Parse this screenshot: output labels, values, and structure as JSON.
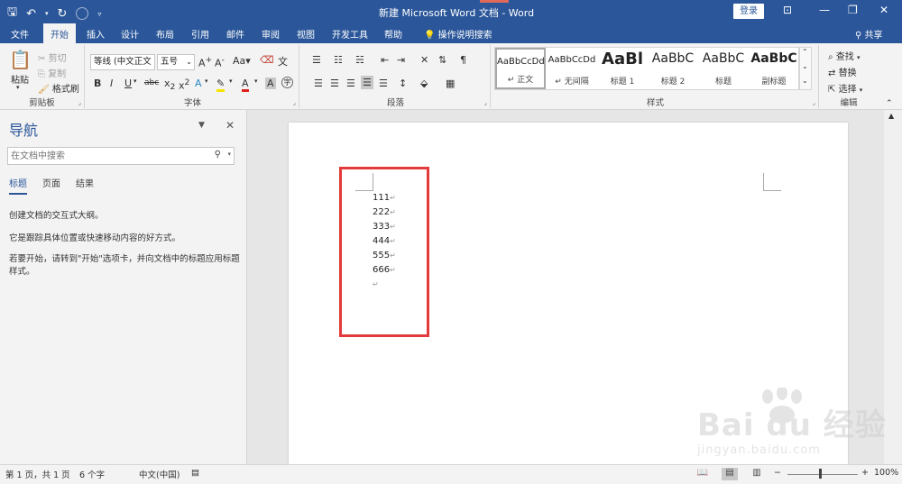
{
  "titlebar": {
    "title": "新建 Microsoft Word 文档  -  Word",
    "login": "登录",
    "qat_icons": [
      "save-icon",
      "undo-icon",
      "redo-icon",
      "touch-mode-icon",
      "customize-qat-icon"
    ]
  },
  "tabs": [
    {
      "label": "文件"
    },
    {
      "label": "开始"
    },
    {
      "label": "插入"
    },
    {
      "label": "设计"
    },
    {
      "label": "布局"
    },
    {
      "label": "引用"
    },
    {
      "label": "邮件"
    },
    {
      "label": "审阅"
    },
    {
      "label": "视图"
    },
    {
      "label": "开发工具"
    },
    {
      "label": "帮助"
    }
  ],
  "tell_me": "操作说明搜索",
  "share": "共享",
  "ribbon": {
    "clipboard": {
      "label": "剪贴板",
      "paste": "粘贴",
      "cut": "剪切",
      "copy": "复制",
      "format_painter": "格式刷"
    },
    "font": {
      "label": "字体",
      "font_name": "等线 (中文正文",
      "font_size": "五号",
      "change_case": "Aa"
    },
    "paragraph": {
      "label": "段落"
    },
    "styles": {
      "label": "样式",
      "items": [
        {
          "sample": "AaBbCcDd",
          "name": "↵ 正文"
        },
        {
          "sample": "AaBbCcDd",
          "name": "↵ 无间隔"
        },
        {
          "sample": "AaBl",
          "name": "标题 1"
        },
        {
          "sample": "AaBbC",
          "name": "标题 2"
        },
        {
          "sample": "AaBbC",
          "name": "标题"
        },
        {
          "sample": "AaBbC",
          "name": "副标题"
        }
      ]
    },
    "editing": {
      "label": "编辑",
      "find": "查找",
      "replace": "替换",
      "select": "选择"
    }
  },
  "navigation": {
    "title": "导航",
    "search_placeholder": "在文档中搜索",
    "tabs": [
      "标题",
      "页面",
      "结果"
    ],
    "line1": "创建文档的交互式大纲。",
    "line2": "它是跟踪具体位置或快速移动内容的好方式。",
    "line3": "若要开始，请转到\"开始\"选项卡，并向文档中的标题应用标题样式。"
  },
  "document": {
    "lines": [
      "111",
      "222",
      "333",
      "444",
      "555",
      "666"
    ],
    "paragraph_mark": "↵"
  },
  "watermark": {
    "main": "Bai du 经验",
    "sub": "jingyan.baidu.com"
  },
  "statusbar": {
    "page": "第 1 页，共 1 页",
    "words": "6 个字",
    "language": "中文(中国)",
    "zoom_minus": "−",
    "zoom_plus": "+",
    "zoom": "100%"
  },
  "colors": {
    "brand": "#2b579a",
    "highlight_box": "#e33b3b",
    "font_color": "#e0201a",
    "highlight_color": "#f5e500"
  }
}
